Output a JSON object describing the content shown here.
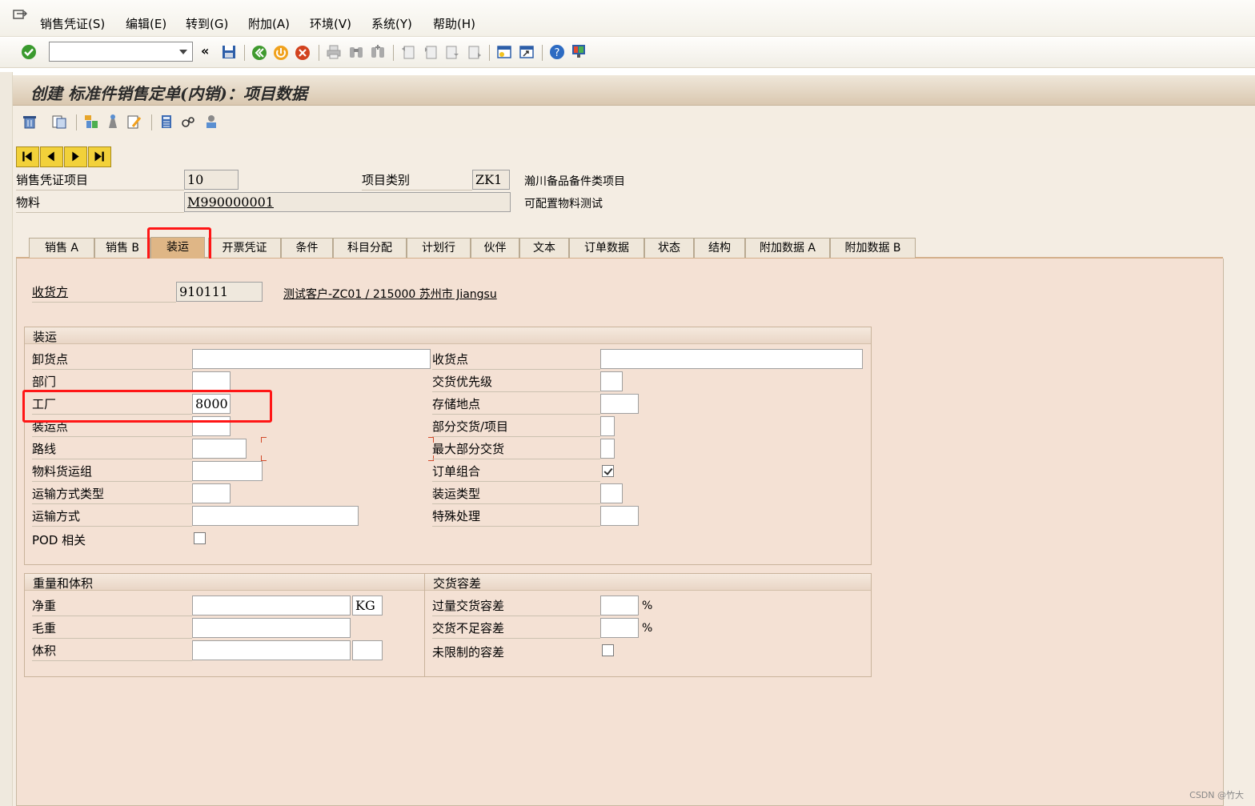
{
  "menu": {
    "items": [
      "销售凭证(S)",
      "编辑(E)",
      "转到(G)",
      "附加(A)",
      "环境(V)",
      "系统(Y)",
      "帮助(H)"
    ]
  },
  "toolbar": {
    "command_value": ""
  },
  "title": "创建 标准件销售定单(内销)：项目数据",
  "header": {
    "item_label": "销售凭证项目",
    "item_value": "10",
    "category_label": "项目类别",
    "category_value": "ZK1",
    "category_desc": "瀚川备品备件类项目",
    "material_label": "物料",
    "material_value": "M990000001",
    "material_desc": "可配置物料测试"
  },
  "tabs": [
    "销售 A",
    "销售 B",
    "装运",
    "开票凭证",
    "条件",
    "科目分配",
    "计划行",
    "伙伴",
    "文本",
    "订单数据",
    "状态",
    "结构",
    "附加数据 A",
    "附加数据 B"
  ],
  "active_tab": "装运",
  "shipto": {
    "label": "收货方",
    "value": "910111",
    "desc": "测试客户-ZC01 / 215000 苏州市 Jiangsu"
  },
  "shipping": {
    "title": "装运",
    "unloading_point": {
      "label": "卸货点",
      "value": ""
    },
    "department": {
      "label": "部门",
      "value": ""
    },
    "plant": {
      "label": "工厂",
      "value": "8000"
    },
    "shipping_point": {
      "label": "装运点",
      "value": ""
    },
    "route": {
      "label": "路线",
      "value": ""
    },
    "mat_freight_group": {
      "label": "物料货运组",
      "value": ""
    },
    "transport_mode_type": {
      "label": "运输方式类型",
      "value": ""
    },
    "transport_mode": {
      "label": "运输方式",
      "value": ""
    },
    "pod_relevant": {
      "label": "POD 相关",
      "checked": false
    },
    "receiving_point": {
      "label": "收货点",
      "value": ""
    },
    "delivery_priority": {
      "label": "交货优先级",
      "value": ""
    },
    "storage_location": {
      "label": "存储地点",
      "value": ""
    },
    "partial_delivery_item": {
      "label": "部分交货/项目",
      "value": ""
    },
    "max_partial_deliveries": {
      "label": "最大部分交货",
      "value": ""
    },
    "order_combination": {
      "label": "订单组合",
      "checked": true
    },
    "shipping_type": {
      "label": "装运类型",
      "value": ""
    },
    "special_processing": {
      "label": "特殊处理",
      "value": ""
    }
  },
  "weight_volume": {
    "title": "重量和体积",
    "net_weight": {
      "label": "净重",
      "value": "",
      "unit": "KG"
    },
    "gross_weight": {
      "label": "毛重",
      "value": ""
    },
    "volume": {
      "label": "体积",
      "value": "",
      "unit": ""
    }
  },
  "delivery_tolerance": {
    "title": "交货容差",
    "overdelivery": {
      "label": "过量交货容差",
      "value": "",
      "unit": "%"
    },
    "underdelivery": {
      "label": "交货不足容差",
      "value": "",
      "unit": "%"
    },
    "unlimited": {
      "label": "未限制的容差",
      "checked": false
    }
  },
  "watermark": "CSDN @竹大"
}
